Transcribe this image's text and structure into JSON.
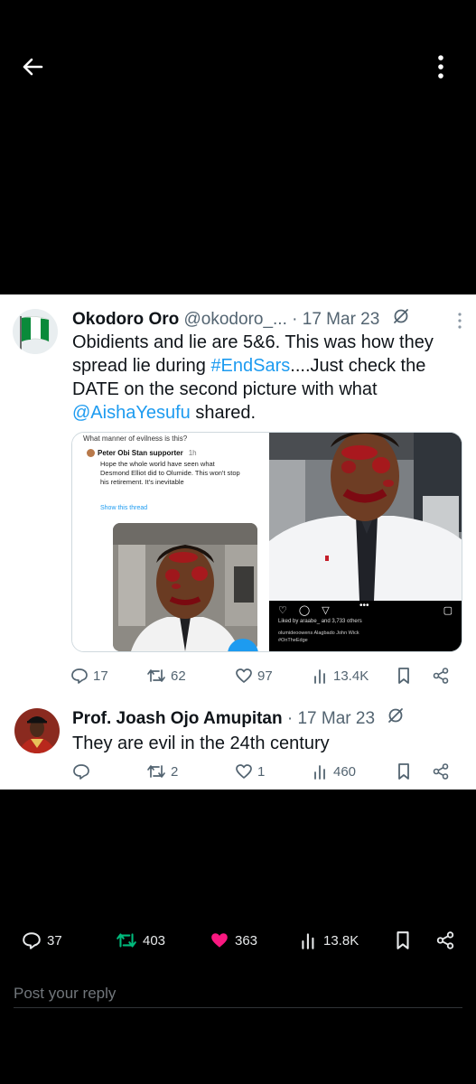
{
  "screen": {
    "icons": {
      "back": "arrow-left-icon",
      "more": "more-vertical-icon"
    }
  },
  "tweets": [
    {
      "name": "Okodoro Oro",
      "handle": "@okodoro_...",
      "dot": "·",
      "date": "17 Mar 23",
      "text_parts": {
        "p1": "Obidients and lie are 5&6. This was how they spread lie during ",
        "hashtag": "#EndSars",
        "p2": "....Just check the DATE on the second picture with what ",
        "mention": "@AishaYesufu",
        "p3": " shared."
      },
      "media": {
        "left": {
          "header": "What manner of evilness is this?",
          "user": "Peter Obi Stan supporter",
          "time": "1h",
          "body": "Hope the whole world have seen what Desmond Elliot did to Olumide. This won't stop his retirement. It's inevitable",
          "show_thread": "Show this thread"
        },
        "right": {
          "dots": "•••",
          "liked": "Liked by araabe_ and 3,733 others",
          "caption1": "olumideoowens Alagbado John Wick",
          "caption2": "#OnTheEdge"
        }
      },
      "stats": {
        "replies": "17",
        "retweets": "62",
        "likes": "97",
        "views": "13.4K"
      }
    },
    {
      "name": "Prof. Joash Ojo Amupitan",
      "dot": "·",
      "date": "17 Mar 23",
      "text": "They are evil in the 24th century",
      "stats": {
        "replies": "",
        "retweets": "2",
        "likes": "1",
        "views": "460"
      }
    }
  ],
  "post_stats": {
    "replies": "37",
    "retweets": "403",
    "likes": "363",
    "views": "13.8K"
  },
  "reply_box": {
    "placeholder": "Post your reply"
  },
  "colors": {
    "background": "#000000",
    "card": "#ffffff",
    "link": "#1d9bf0",
    "muted": "#536471",
    "retweet_green": "#00ba7c",
    "like_pink": "#f91880"
  }
}
